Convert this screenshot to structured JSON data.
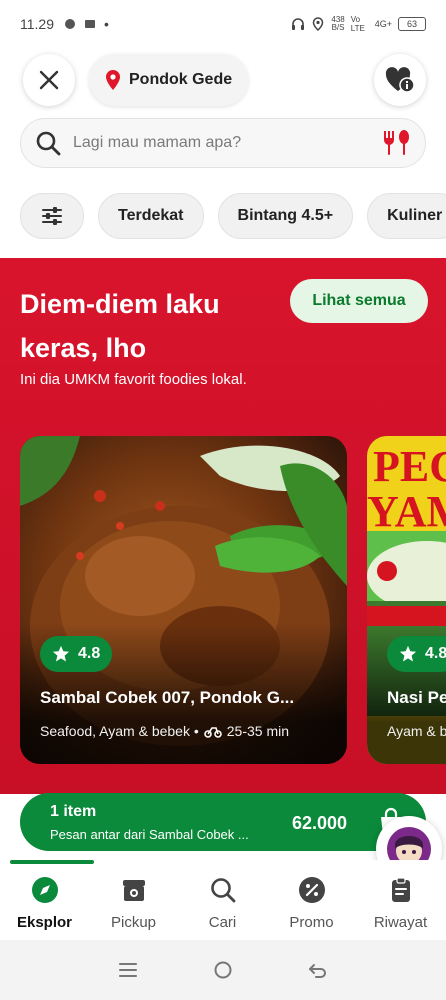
{
  "status_bar": {
    "time": "11.29",
    "net_speed_value": "438",
    "net_speed_unit": "B/S",
    "carrier": "Vo LTE",
    "signal": "4G+",
    "battery": "63"
  },
  "header": {
    "location": "Pondok Gede"
  },
  "search": {
    "placeholder": "Lagi mau mamam apa?"
  },
  "filters": {
    "chips": [
      "Terdekat",
      "Bintang 4.5+",
      "Kuliner"
    ]
  },
  "promo": {
    "title": "Diem-diem laku keras, lho",
    "subtitle": "Ini dia UMKM favorit foodies lokal.",
    "see_all_label": "Lihat semua",
    "background_color": "#d8142c"
  },
  "cards": [
    {
      "rating": "4.8",
      "name": "Sambal Cobek 007, Pondok G...",
      "categories": "Seafood, Ayam & bebek •",
      "eta": "25-35 min"
    },
    {
      "rating": "4.8",
      "name": "Nasi Pe",
      "categories": "Ayam & be",
      "sign_text_1": "PEC",
      "sign_text_2": "YAM"
    }
  ],
  "cart": {
    "count": "1 item",
    "description": "Pesan antar dari Sambal Cobek ...",
    "total": "62.000",
    "accent_color": "#0a8a3a"
  },
  "bottom_nav": {
    "items": [
      {
        "label": "Eksplor",
        "icon": "compass-icon"
      },
      {
        "label": "Pickup",
        "icon": "store-icon"
      },
      {
        "label": "Cari",
        "icon": "search-icon"
      },
      {
        "label": "Promo",
        "icon": "percent-icon"
      },
      {
        "label": "Riwayat",
        "icon": "clipboard-icon"
      }
    ]
  }
}
